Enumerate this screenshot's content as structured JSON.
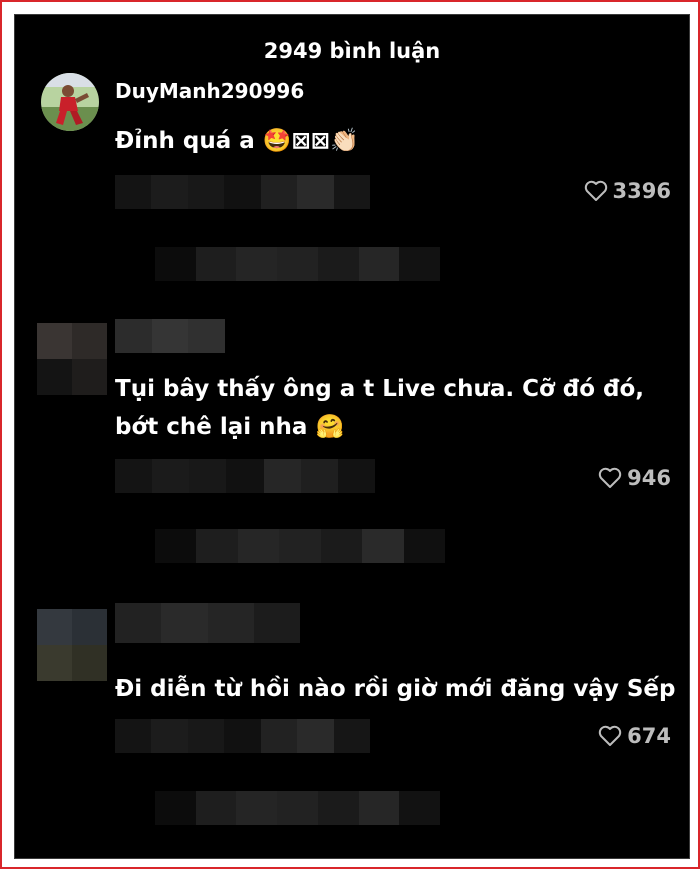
{
  "header": {
    "title": "2949 bình luận"
  },
  "comments": [
    {
      "username": "DuyManh290996",
      "text": "Đỉnh quá a 🤩⊠⊠👏🏻",
      "likes": "3396"
    },
    {
      "username": "",
      "text_line1": "Tụi bây thấy ông a t Live chưa. Cỡ đó đó,",
      "text_line2": "bớt chê lại nha 🤗",
      "likes": "946"
    },
    {
      "username": "",
      "text": "Đi diễn từ hồi nào rồi giờ mới đăng vậy Sếp",
      "likes": "674"
    }
  ],
  "icons": {
    "like": "heart-outline-icon"
  },
  "colors": {
    "frame_border": "#d9262b",
    "background": "#000000",
    "text": "#ffffff",
    "muted": "#bdbdbd"
  }
}
